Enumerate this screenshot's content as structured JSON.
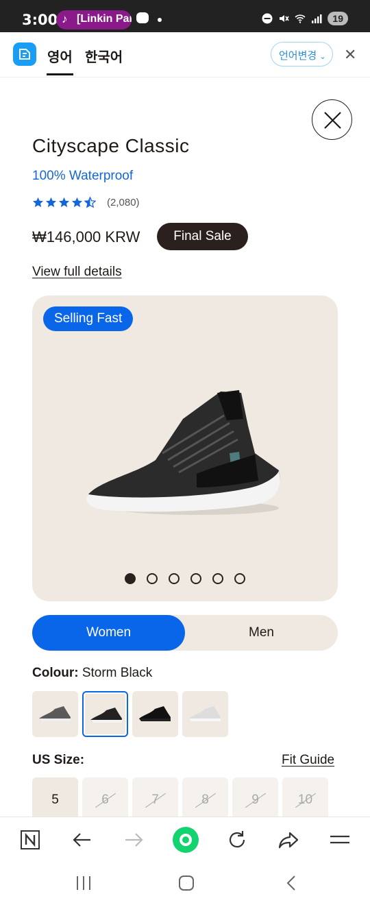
{
  "status_bar": {
    "time": "3:00",
    "media_pill": "[Linkin Park",
    "battery": "19",
    "icons": [
      "music-note-icon",
      "chat-bubble-icon",
      "dnd-icon",
      "mute-icon",
      "wifi-icon",
      "signal-icon"
    ]
  },
  "translator": {
    "tab_source": "영어",
    "tab_target": "한국어",
    "language_change": "언어변경",
    "accent": "#1a9ef5"
  },
  "product": {
    "name": "Cityscape Classic",
    "feature": "100% Waterproof",
    "rating": 4.5,
    "reviews": "(2,080)",
    "price": "₩146,000 KRW",
    "sale_badge": "Final Sale",
    "details_link": "View full details",
    "gallery_badge": "Selling Fast",
    "gallery_count": 6,
    "gallery_active_index": 0
  },
  "gender": {
    "women": "Women",
    "men": "Men",
    "selected": "Women"
  },
  "colour": {
    "label": "Colour:",
    "value": "Storm Black",
    "swatches": [
      "Grey",
      "Storm Black",
      "Black",
      "White"
    ],
    "selected_index": 1
  },
  "size": {
    "label": "US Size:",
    "fit_guide": "Fit Guide",
    "options": [
      {
        "value": "5",
        "available": true
      },
      {
        "value": "6",
        "available": false
      },
      {
        "value": "7",
        "available": false
      },
      {
        "value": "8",
        "available": false
      },
      {
        "value": "9",
        "available": false
      },
      {
        "value": "10",
        "available": false
      }
    ]
  },
  "colors": {
    "brand_blue": "#0a66e8",
    "dark": "#2a211e",
    "beige": "#efe9e2"
  }
}
